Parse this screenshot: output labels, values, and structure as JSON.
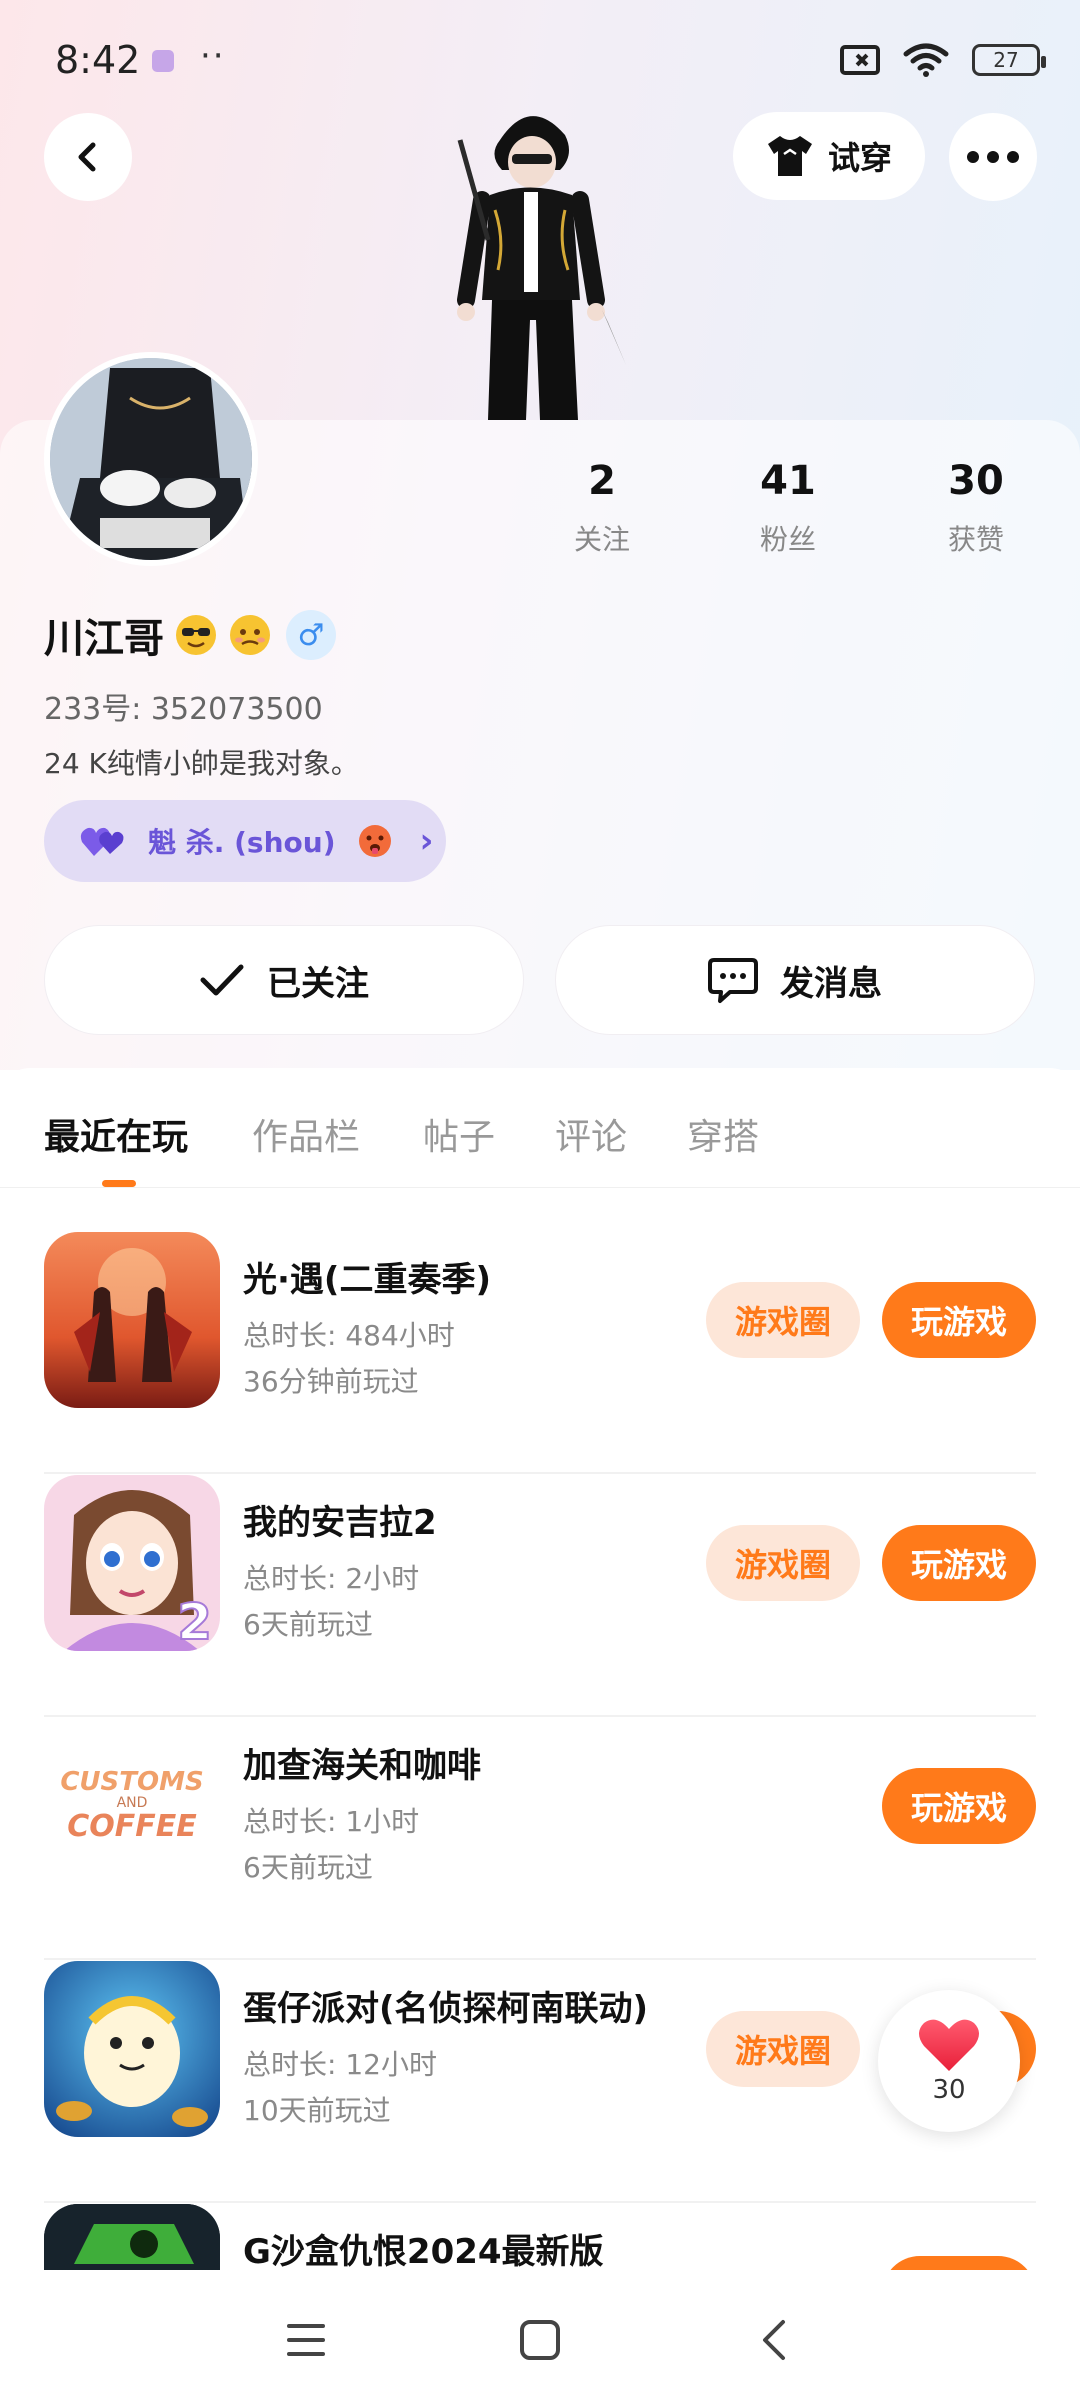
{
  "status_bar": {
    "time": "8:42",
    "dots": "··",
    "battery_level": "27"
  },
  "header": {
    "try_on_label": "试穿"
  },
  "profile": {
    "stats": [
      {
        "value": "2",
        "label": "关注"
      },
      {
        "value": "41",
        "label": "粉丝"
      },
      {
        "value": "30",
        "label": "获赞"
      }
    ],
    "name": "川江哥",
    "gender_symbol": "♂",
    "uid": "233号: 352073500",
    "bio": "24 K纯情小帥是我对象。",
    "cp_label": "魁 杀. (shou)",
    "cp_arrow": "›"
  },
  "actions": {
    "follow_label": "已关注",
    "message_label": "发消息"
  },
  "tabs": [
    {
      "label": "最近在玩",
      "active": true
    },
    {
      "label": "作品栏",
      "active": false
    },
    {
      "label": "帖子",
      "active": false
    },
    {
      "label": "评论",
      "active": false
    },
    {
      "label": "穿搭",
      "active": false
    }
  ],
  "games": [
    {
      "title": "光·遇(二重奏季)",
      "duration": "总时长: 484小时",
      "last_played": "36分钟前玩过",
      "circle_label": "游戏圈",
      "play_label": "玩游戏"
    },
    {
      "title": "我的安吉拉2",
      "duration": "总时长: 2小时",
      "last_played": "6天前玩过",
      "circle_label": "游戏圈",
      "play_label": "玩游戏"
    },
    {
      "title": "加查海关和咖啡",
      "duration": "总时长: 1小时",
      "last_played": "6天前玩过",
      "circle_label": "",
      "play_label": "玩游戏"
    },
    {
      "title": "蛋仔派对(名侦探柯南联动)",
      "duration": "总时长: 12小时",
      "last_played": "10天前玩过",
      "circle_label": "游戏圈",
      "play_label": "玩游戏"
    },
    {
      "title": "G沙盒仇恨2024最新版",
      "duration": "",
      "last_played": "",
      "circle_label": "",
      "play_label": ""
    }
  ],
  "game_icon_text": {
    "angela_badge": "2",
    "coffee_line1": "CUSTOMS",
    "coffee_line2": "AND",
    "coffee_line3": "COFFEE"
  },
  "like_fab": {
    "count": "30"
  },
  "colors": {
    "accent": "#ff7a1a",
    "accent_soft": "#fde6d8",
    "cp_purple": "#6a55d8",
    "gender_blue": "#3b8dee"
  }
}
